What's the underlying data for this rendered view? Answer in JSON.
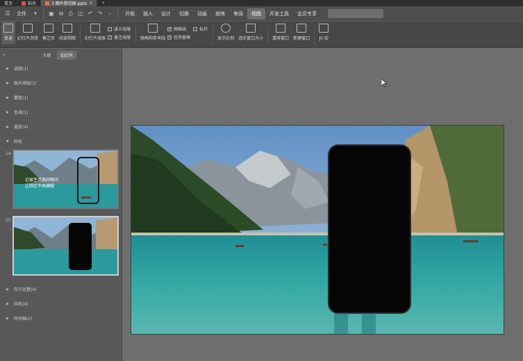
{
  "tabs": [
    {
      "label": "首页",
      "active": false
    },
    {
      "label": "稻壳",
      "active": false
    },
    {
      "label": "3 图片剪切屏.pptx",
      "active": true
    }
  ],
  "new_tab_label": "+",
  "menu": {
    "file_label": "文件",
    "items": [
      "开始",
      "插入",
      "设计",
      "切换",
      "动画",
      "放映",
      "审阅",
      "视图",
      "开发工具",
      "会员专享"
    ],
    "active_item": "视图"
  },
  "ribbon": {
    "view_normal": "普通",
    "slide_sorter": "幻灯片浏览",
    "notes_page": "备注页",
    "reading_view": "阅读视图",
    "slide_master": "幻灯片母版",
    "handout_master": "讲义母版",
    "notes_master": "备注母版",
    "grid_guides": "网格和参考线",
    "gridlines": "网格线",
    "ruler": "标尺",
    "task_pane": "任务窗格",
    "zoom": "显示比例",
    "fit_window": "适应窗口大小",
    "arrange_all": "重排窗口",
    "new_window": "新建窗口",
    "macro": "JS 宏"
  },
  "panel": {
    "tab_outline": "大纲",
    "tab_slides": "幻灯片",
    "sections_top": [
      "选图(1)",
      "图片排版(2)",
      "蒙版(1)",
      "色调(1)",
      "裁剪(4)"
    ],
    "expanded_section": "样机",
    "thumb_numbers": [
      "14",
      "15"
    ],
    "thumb14_line1": "记录生活美好瞬间",
    "thumb14_line2": "让回忆不再模糊",
    "sections_bottom": [
      "布尔运算(4)",
      "样机(4)",
      "时间轴(2)"
    ]
  },
  "colors": {
    "sky": "#8fb6d6",
    "lake": "#2a9a9c",
    "phone": "#050505"
  }
}
